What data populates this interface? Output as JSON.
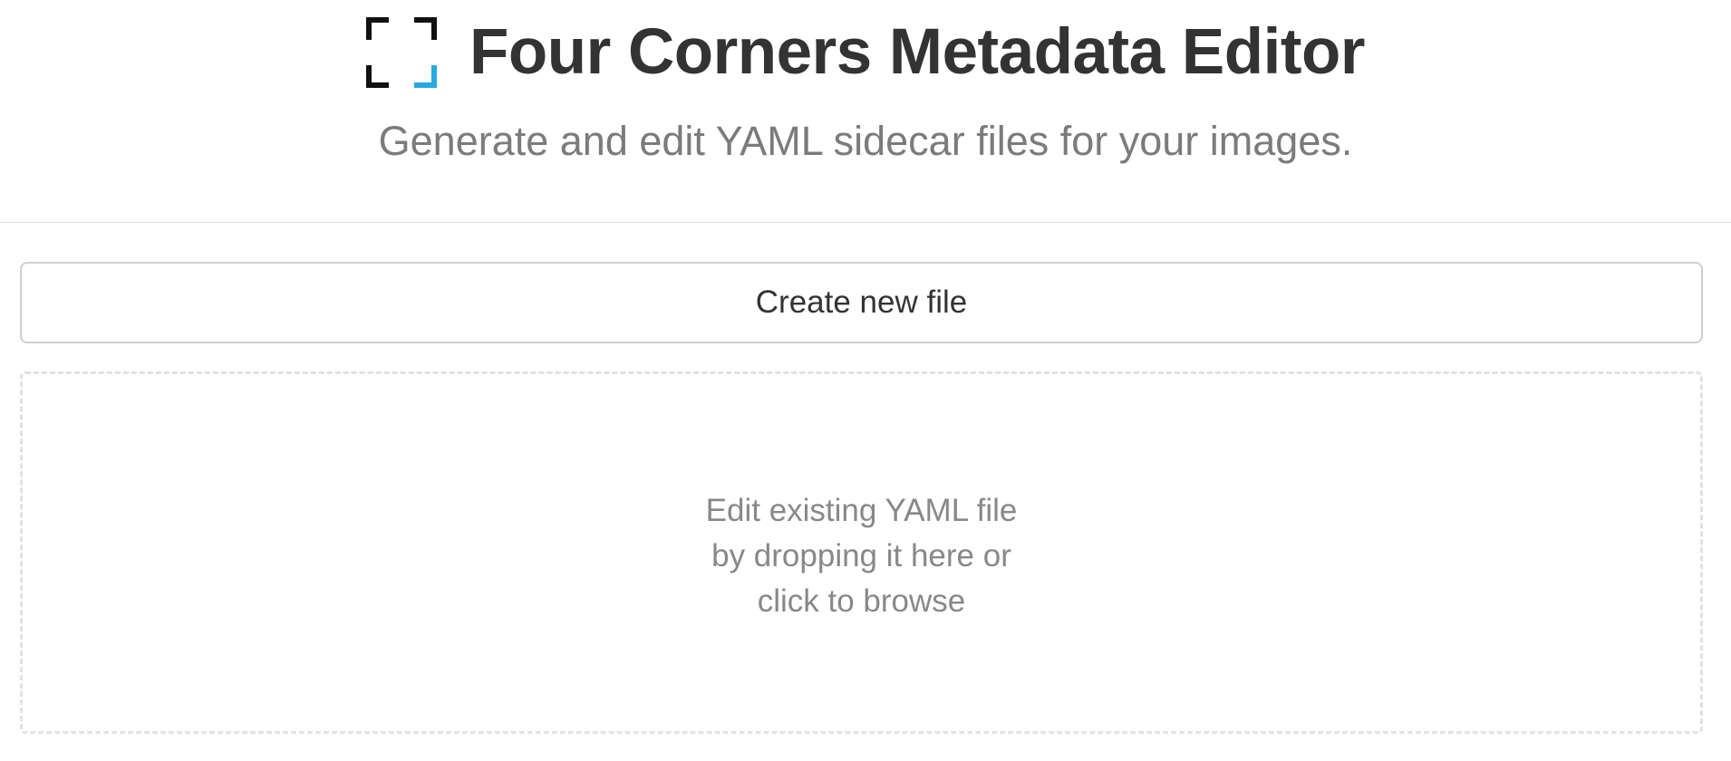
{
  "header": {
    "title": "Four Corners Metadata Editor",
    "subtitle": "Generate and edit YAML sidecar files for your images.",
    "logo_icon": "four-corners-frame-icon",
    "logo_colors": {
      "dark": "#111111",
      "accent": "#29a9e1"
    }
  },
  "actions": {
    "create_label": "Create new file"
  },
  "dropzone": {
    "lines": [
      "Edit existing YAML file",
      "by dropping it here or",
      "click to browse"
    ]
  }
}
